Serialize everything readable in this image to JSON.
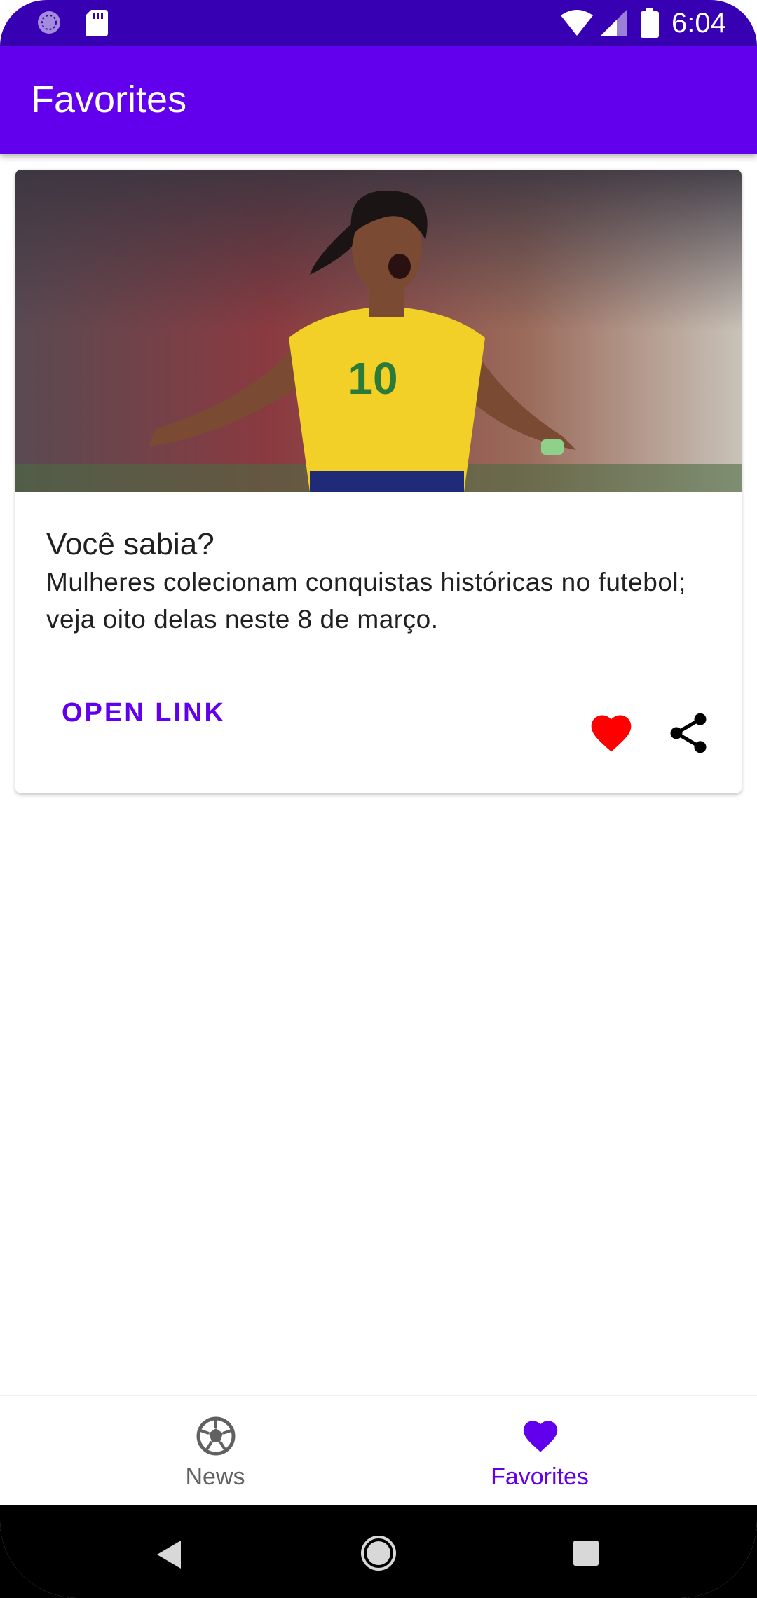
{
  "status_bar": {
    "time": "6:04",
    "icons": [
      "sync-icon",
      "sd-card-icon",
      "wifi-icon",
      "signal-icon",
      "battery-icon"
    ]
  },
  "app_bar": {
    "title": "Favorites"
  },
  "card": {
    "image_icon": "soccer-player-photo",
    "title": "Você sabia?",
    "body": "Mulheres colecionam conquistas históricas no futebol; veja oito delas neste 8 de março.",
    "open_link_label": "OPEN LINK",
    "favorite_icon": "heart-icon",
    "share_icon": "share-icon",
    "favorite_color": "#ff0000"
  },
  "bottom_nav": {
    "items": [
      {
        "label": "News",
        "icon": "soccer-ball-icon",
        "selected": false
      },
      {
        "label": "Favorites",
        "icon": "heart-icon",
        "selected": true
      }
    ]
  },
  "colors": {
    "primary": "#6200ee",
    "primary_dark": "#3700b3",
    "inactive": "#616161"
  },
  "system_nav": {
    "icons": [
      "back-icon",
      "home-icon",
      "recents-icon"
    ]
  }
}
